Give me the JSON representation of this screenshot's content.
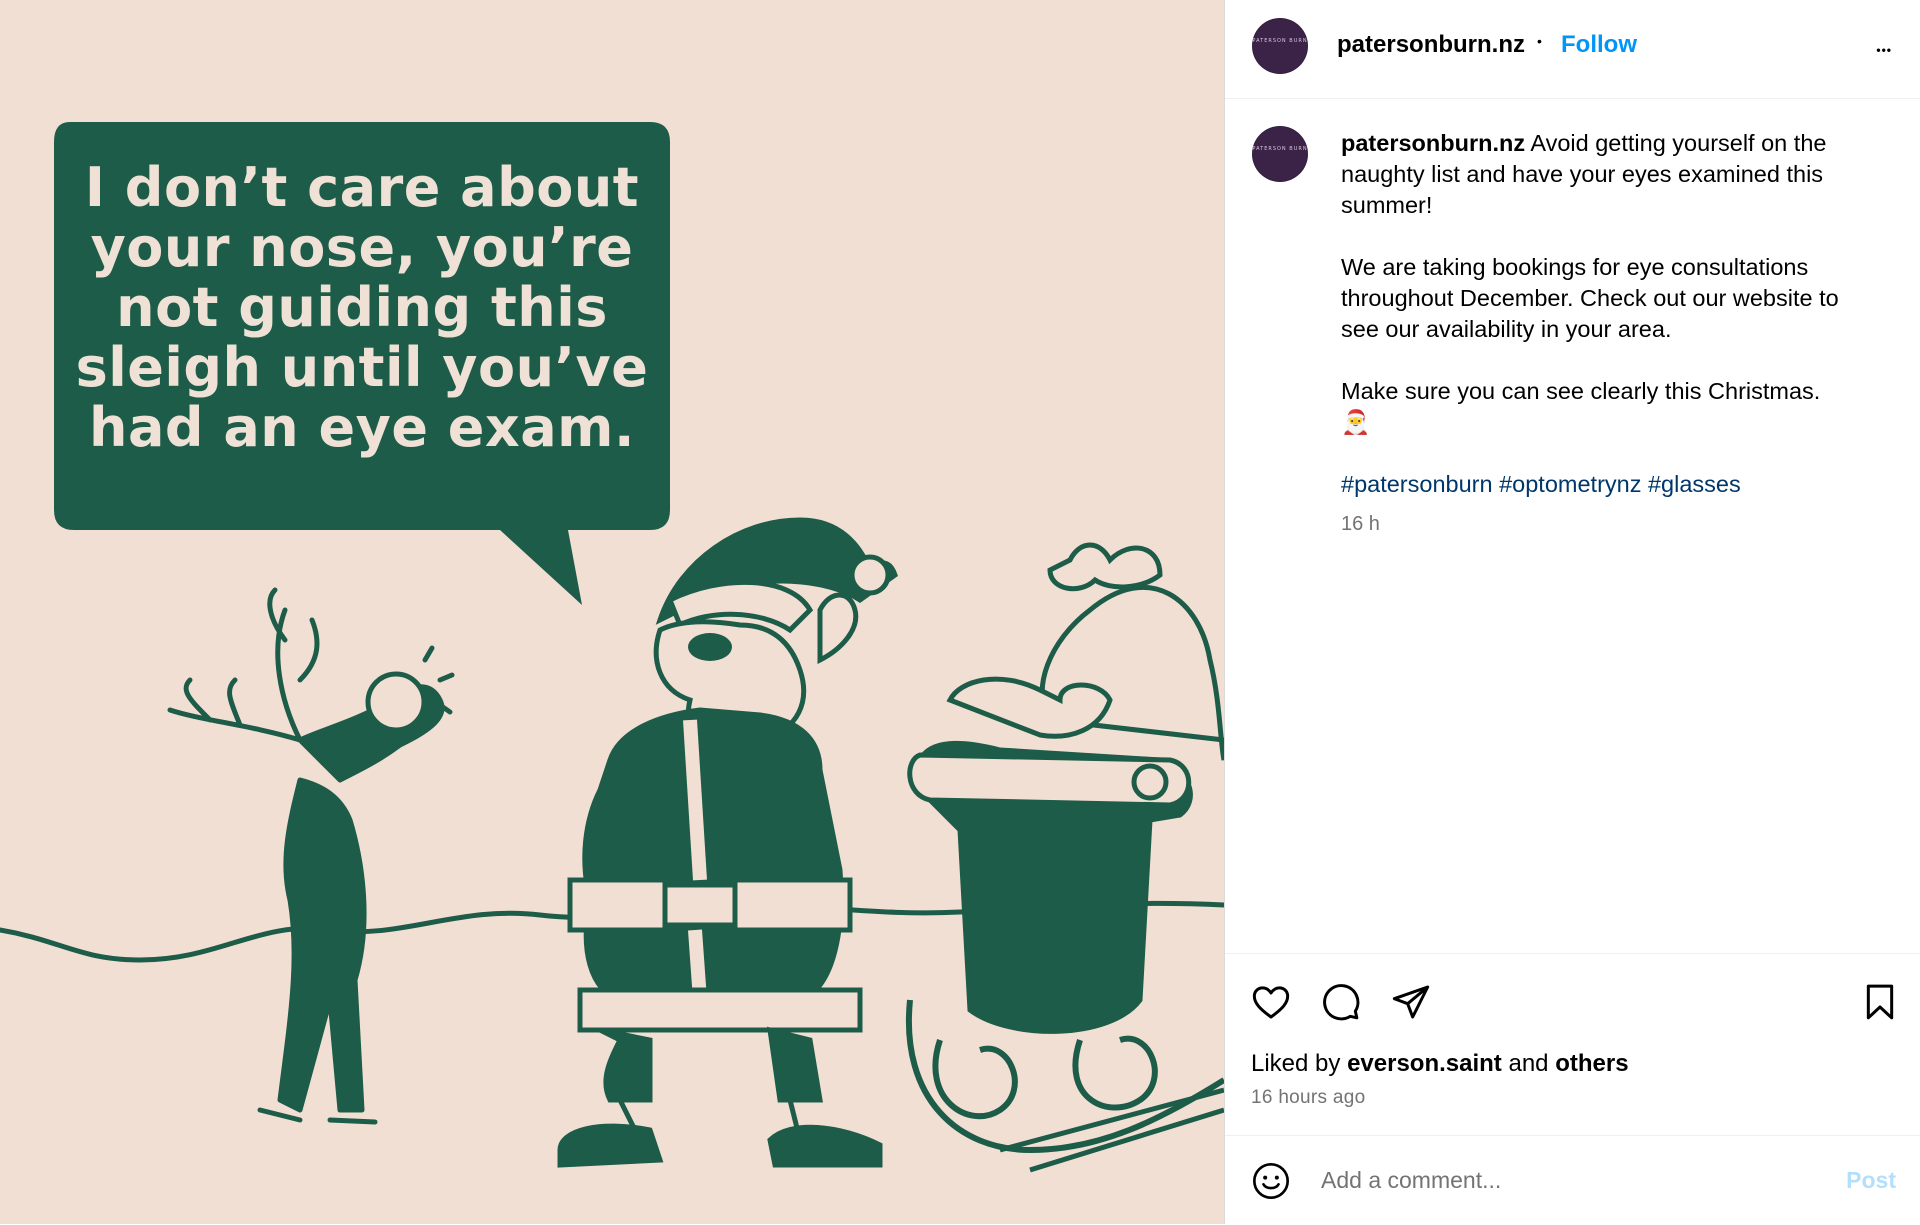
{
  "post": {
    "image": {
      "bubble_lines": [
        "I don’t care about",
        "your nose, you’re",
        "not guiding this",
        "sleigh until you’ve",
        "had an eye exam."
      ],
      "colors": {
        "background": "#f2dfd3",
        "ink": "#1d5c48"
      }
    },
    "header": {
      "avatar_text": "PATERSON BURN",
      "username": "patersonburn.nz",
      "separator": "•",
      "follow_label": "Follow",
      "more_label": "•••"
    },
    "caption": {
      "username": "patersonburn.nz",
      "line1": "Avoid getting yourself on the naughty list and have your eyes examined this summer!",
      "line2": "We are taking bookings for eye consultations throughout December. Check out our website to see our availability in your area.",
      "line3": "Make sure you can see clearly this Christmas.",
      "emoji": "🎅",
      "hashtags": "#patersonburn #optometrynz #glasses",
      "time": "16 h"
    },
    "actions": {
      "icons": [
        "heart-icon",
        "comment-icon",
        "share-icon",
        "bookmark-icon"
      ]
    },
    "likes": {
      "prefix": "Liked by",
      "user": "everson.saint",
      "conj": "and",
      "others": "others"
    },
    "timestamp": "16 hours ago",
    "comment": {
      "placeholder": "Add a comment...",
      "post_label": "Post"
    },
    "colors": {
      "link": "#0095f6",
      "hashtag": "#00376b",
      "muted": "#737373"
    }
  }
}
